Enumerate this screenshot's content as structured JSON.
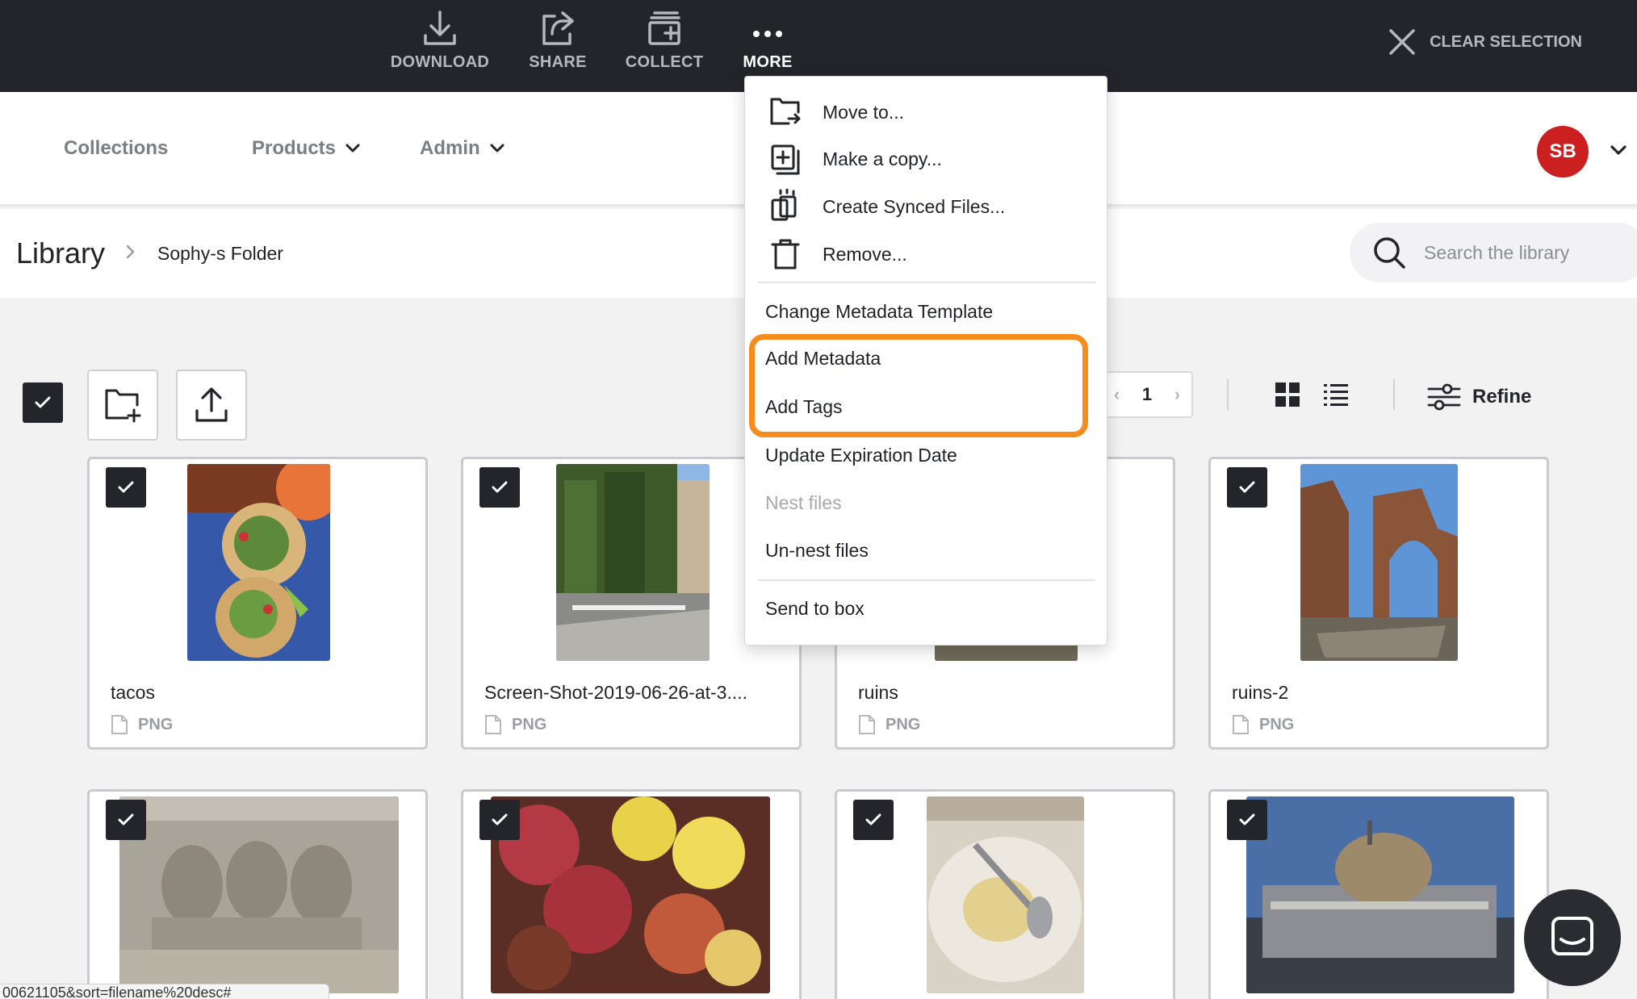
{
  "actionbar": {
    "download": "DOWNLOAD",
    "share": "SHARE",
    "collect": "COLLECT",
    "more": "MORE",
    "clear_selection": "CLEAR SELECTION"
  },
  "nav": {
    "collections": "Collections",
    "products": "Products",
    "admin": "Admin",
    "avatar_initials": "SB"
  },
  "breadcrumb": {
    "root": "Library",
    "folder": "Sophy-s Folder"
  },
  "search": {
    "placeholder": "Search the library"
  },
  "pagination": {
    "page": "1"
  },
  "refine_label": "Refine",
  "menu": {
    "items": [
      {
        "label": "Move to...",
        "icon": "move-icon"
      },
      {
        "label": "Make a copy...",
        "icon": "copy-icon"
      },
      {
        "label": "Create Synced Files...",
        "icon": "synced-files-icon"
      },
      {
        "label": "Remove...",
        "icon": "trash-icon"
      },
      {
        "label": "Change Metadata Template"
      },
      {
        "label": "Add Metadata"
      },
      {
        "label": "Add Tags"
      },
      {
        "label": "Update Expiration Date"
      },
      {
        "label": "Nest files",
        "disabled": true
      },
      {
        "label": "Un-nest files"
      },
      {
        "label": "Send to box"
      }
    ]
  },
  "files": [
    {
      "name": "tacos",
      "type": "PNG"
    },
    {
      "name": "Screen-Shot-2019-06-26-at-3....",
      "type": "PNG"
    },
    {
      "name": "ruins",
      "type": "PNG"
    },
    {
      "name": "ruins-2",
      "type": "PNG"
    },
    {
      "name": "",
      "type": ""
    },
    {
      "name": "",
      "type": ""
    },
    {
      "name": "",
      "type": ""
    },
    {
      "name": "",
      "type": ""
    }
  ],
  "status_url": "00621105&sort=filename%20desc#",
  "colors": {
    "topbar": "#23252b",
    "highlight": "#f78b1e",
    "avatar": "#cc1f1f"
  }
}
